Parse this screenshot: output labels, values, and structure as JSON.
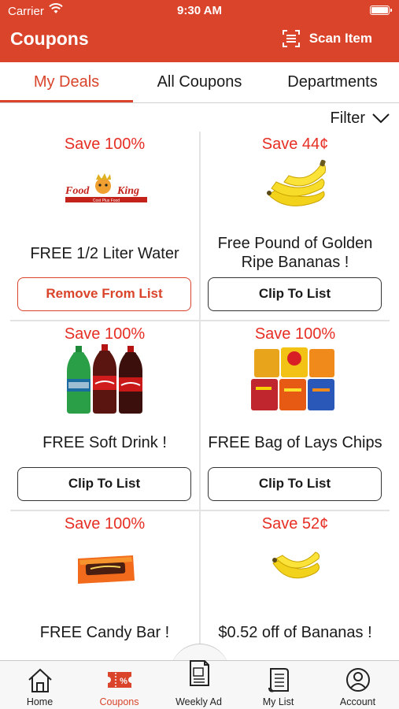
{
  "status_bar": {
    "carrier": "Carrier",
    "time": "9:30 AM"
  },
  "header": {
    "title": "Coupons",
    "scan_label": "Scan Item",
    "background": "#d9442b"
  },
  "tabs": [
    {
      "label": "My Deals",
      "active": true
    },
    {
      "label": "All Coupons",
      "active": false
    },
    {
      "label": "Departments",
      "active": false
    }
  ],
  "filter_label": "Filter",
  "coupons": [
    {
      "save": "Save 100%",
      "description": "FREE 1/2 Liter Water",
      "button": "Remove From List",
      "image": "food-king-logo",
      "logo_text_1": "Food",
      "logo_text_2": "King",
      "logo_tagline": "Cost Plus Food"
    },
    {
      "save": "Save 44¢",
      "description": "Free Pound of Golden Ripe Bananas !",
      "button": "Clip To List",
      "image": "bananas-icon"
    },
    {
      "save": "Save 100%",
      "description": "FREE Soft Drink !",
      "button": "Clip To List",
      "image": "soda-bottles-icon"
    },
    {
      "save": "Save 100%",
      "description": "FREE Bag of Lays Chips",
      "button": "Clip To List",
      "image": "chip-bags-icon"
    },
    {
      "save": "Save 100%",
      "description": "FREE Candy Bar !",
      "button": "",
      "image": "candy-bar-icon"
    },
    {
      "save": "Save 52¢",
      "description": "$0.52 off of Bananas !",
      "button": "",
      "image": "bananas-icon"
    }
  ],
  "bottom_nav": [
    {
      "label": "Home",
      "icon": "home-icon",
      "active": false
    },
    {
      "label": "Coupons",
      "icon": "coupon-icon",
      "active": true
    },
    {
      "label": "Weekly Ad",
      "icon": "weekly-ad-icon",
      "active": false
    },
    {
      "label": "My List",
      "icon": "my-list-icon",
      "active": false
    },
    {
      "label": "Account",
      "icon": "account-icon",
      "active": false
    }
  ],
  "colors": {
    "accent": "#d9442b",
    "save_text": "#e62e24"
  }
}
